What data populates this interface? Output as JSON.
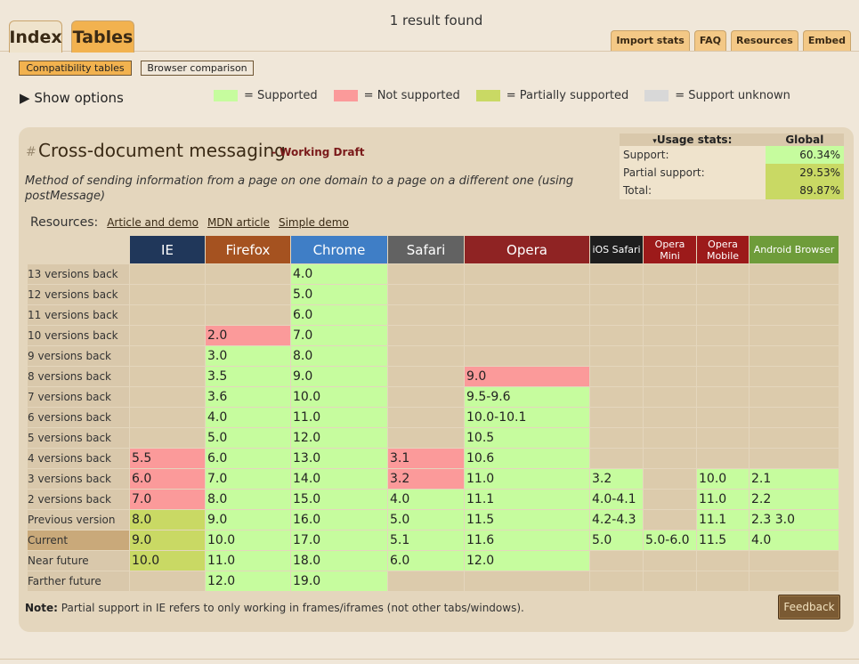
{
  "nav": {
    "index_tab": "Index",
    "tables_tab": "Tables"
  },
  "header": {
    "result": "1 result found"
  },
  "toplinks": [
    "Import stats",
    "FAQ",
    "Resources",
    "Embed"
  ],
  "subnav": {
    "compat": "Compatibility tables",
    "browser": "Browser comparison"
  },
  "options": {
    "show": "Show options"
  },
  "legend": [
    {
      "label": "= Supported",
      "color": "#c6fc9e"
    },
    {
      "label": "= Not supported",
      "color": "#fb9a9a"
    },
    {
      "label": "= Partially supported",
      "color": "#c9d964"
    },
    {
      "label": "= Support unknown",
      "color": "#d8d8d8"
    }
  ],
  "feature": {
    "hash": "#",
    "title": "Cross-document messaging",
    "status": "- Working Draft",
    "description": "Method of sending information from a page on one domain to a page on a different one (using postMessage)",
    "resources_label": "Resources:",
    "resources": [
      "Article and demo",
      "MDN article",
      "Simple demo"
    ]
  },
  "usage": {
    "header": "Usage stats:",
    "scope": "Global",
    "rows": [
      {
        "label": "Support:",
        "value": "60.34%",
        "color": "#c6fc9e"
      },
      {
        "label": "Partial support:",
        "value": "29.53%",
        "color": "#c9d964"
      },
      {
        "label": "Total:",
        "value": "89.87%",
        "color": "#c9d964"
      }
    ]
  },
  "browsers": [
    {
      "name": "IE",
      "color": "#20375a"
    },
    {
      "name": "Firefox",
      "color": "#a55220"
    },
    {
      "name": "Chrome",
      "color": "#3f7ec6"
    },
    {
      "name": "Safari",
      "color": "#626262"
    },
    {
      "name": "Opera",
      "color": "#8f2323"
    },
    {
      "name": "iOS Safari",
      "color": "#1e1e1e"
    },
    {
      "name": "Opera Mini",
      "color": "#9c1a1a"
    },
    {
      "name": "Opera Mobile",
      "color": "#9c1a1a"
    },
    {
      "name": "Android Browser",
      "color": "#6e9c3a"
    }
  ],
  "rows": [
    {
      "label": "13 versions back",
      "cells": [
        [
          "",
          ""
        ],
        [
          "",
          ""
        ],
        [
          "4.0",
          "y"
        ],
        [
          "",
          ""
        ],
        [
          "",
          ""
        ],
        [
          "",
          ""
        ],
        [
          "",
          ""
        ],
        [
          "",
          ""
        ],
        [
          "",
          ""
        ]
      ]
    },
    {
      "label": "12 versions back",
      "cells": [
        [
          "",
          ""
        ],
        [
          "",
          ""
        ],
        [
          "5.0",
          "y"
        ],
        [
          "",
          ""
        ],
        [
          "",
          ""
        ],
        [
          "",
          ""
        ],
        [
          "",
          ""
        ],
        [
          "",
          ""
        ],
        [
          "",
          ""
        ]
      ]
    },
    {
      "label": "11 versions back",
      "cells": [
        [
          "",
          ""
        ],
        [
          "",
          ""
        ],
        [
          "6.0",
          "y"
        ],
        [
          "",
          ""
        ],
        [
          "",
          ""
        ],
        [
          "",
          ""
        ],
        [
          "",
          ""
        ],
        [
          "",
          ""
        ],
        [
          "",
          ""
        ]
      ]
    },
    {
      "label": "10 versions back",
      "cells": [
        [
          "",
          ""
        ],
        [
          "2.0",
          "n"
        ],
        [
          "7.0",
          "y"
        ],
        [
          "",
          ""
        ],
        [
          "",
          ""
        ],
        [
          "",
          ""
        ],
        [
          "",
          ""
        ],
        [
          "",
          ""
        ],
        [
          "",
          ""
        ]
      ]
    },
    {
      "label": "9 versions back",
      "cells": [
        [
          "",
          ""
        ],
        [
          "3.0",
          "y"
        ],
        [
          "8.0",
          "y"
        ],
        [
          "",
          ""
        ],
        [
          "",
          ""
        ],
        [
          "",
          ""
        ],
        [
          "",
          ""
        ],
        [
          "",
          ""
        ],
        [
          "",
          ""
        ]
      ]
    },
    {
      "label": "8 versions back",
      "cells": [
        [
          "",
          ""
        ],
        [
          "3.5",
          "y"
        ],
        [
          "9.0",
          "y"
        ],
        [
          "",
          ""
        ],
        [
          "9.0",
          "n"
        ],
        [
          "",
          ""
        ],
        [
          "",
          ""
        ],
        [
          "",
          ""
        ],
        [
          "",
          ""
        ]
      ]
    },
    {
      "label": "7 versions back",
      "cells": [
        [
          "",
          ""
        ],
        [
          "3.6",
          "y"
        ],
        [
          "10.0",
          "y"
        ],
        [
          "",
          ""
        ],
        [
          "9.5-9.6",
          "y"
        ],
        [
          "",
          ""
        ],
        [
          "",
          ""
        ],
        [
          "",
          ""
        ],
        [
          "",
          ""
        ]
      ]
    },
    {
      "label": "6 versions back",
      "cells": [
        [
          "",
          ""
        ],
        [
          "4.0",
          "y"
        ],
        [
          "11.0",
          "y"
        ],
        [
          "",
          ""
        ],
        [
          "10.0-10.1",
          "y"
        ],
        [
          "",
          ""
        ],
        [
          "",
          ""
        ],
        [
          "",
          ""
        ],
        [
          "",
          ""
        ]
      ]
    },
    {
      "label": "5 versions back",
      "cells": [
        [
          "",
          ""
        ],
        [
          "5.0",
          "y"
        ],
        [
          "12.0",
          "y"
        ],
        [
          "",
          ""
        ],
        [
          "10.5",
          "y"
        ],
        [
          "",
          ""
        ],
        [
          "",
          ""
        ],
        [
          "",
          ""
        ],
        [
          "",
          ""
        ]
      ]
    },
    {
      "label": "4 versions back",
      "cells": [
        [
          "5.5",
          "n"
        ],
        [
          "6.0",
          "y"
        ],
        [
          "13.0",
          "y"
        ],
        [
          "3.1",
          "n"
        ],
        [
          "10.6",
          "y"
        ],
        [
          "",
          ""
        ],
        [
          "",
          ""
        ],
        [
          "",
          ""
        ],
        [
          "",
          ""
        ]
      ]
    },
    {
      "label": "3 versions back",
      "cells": [
        [
          "6.0",
          "n"
        ],
        [
          "7.0",
          "y"
        ],
        [
          "14.0",
          "y"
        ],
        [
          "3.2",
          "n"
        ],
        [
          "11.0",
          "y"
        ],
        [
          "3.2",
          "y"
        ],
        [
          "",
          ""
        ],
        [
          "10.0",
          "y"
        ],
        [
          "2.1",
          "y"
        ]
      ]
    },
    {
      "label": "2 versions back",
      "cells": [
        [
          "7.0",
          "n"
        ],
        [
          "8.0",
          "y"
        ],
        [
          "15.0",
          "y"
        ],
        [
          "4.0",
          "y"
        ],
        [
          "11.1",
          "y"
        ],
        [
          "4.0-4.1",
          "y"
        ],
        [
          "",
          ""
        ],
        [
          "11.0",
          "y"
        ],
        [
          "2.2",
          "y"
        ]
      ]
    },
    {
      "label": "Previous version",
      "cells": [
        [
          "8.0",
          "p"
        ],
        [
          "9.0",
          "y"
        ],
        [
          "16.0",
          "y"
        ],
        [
          "5.0",
          "y"
        ],
        [
          "11.5",
          "y"
        ],
        [
          "4.2-4.3",
          "y"
        ],
        [
          "",
          ""
        ],
        [
          "11.1",
          "y"
        ],
        [
          "2.3 3.0",
          "y"
        ]
      ]
    },
    {
      "label": "Current",
      "cells": [
        [
          "9.0",
          "p"
        ],
        [
          "10.0",
          "y"
        ],
        [
          "17.0",
          "y"
        ],
        [
          "5.1",
          "y"
        ],
        [
          "11.6",
          "y"
        ],
        [
          "5.0",
          "y"
        ],
        [
          "5.0-6.0",
          "y"
        ],
        [
          "11.5",
          "y"
        ],
        [
          "4.0",
          "y"
        ]
      ]
    },
    {
      "label": "Near future",
      "cells": [
        [
          "10.0",
          "p"
        ],
        [
          "11.0",
          "y"
        ],
        [
          "18.0",
          "y"
        ],
        [
          "6.0",
          "y"
        ],
        [
          "12.0",
          "y"
        ],
        [
          "",
          ""
        ],
        [
          "",
          ""
        ],
        [
          "",
          ""
        ],
        [
          "",
          ""
        ]
      ]
    },
    {
      "label": "Farther future",
      "cells": [
        [
          "",
          ""
        ],
        [
          "12.0",
          "y"
        ],
        [
          "19.0",
          "y"
        ],
        [
          "",
          ""
        ],
        [
          "",
          ""
        ],
        [
          "",
          ""
        ],
        [
          "",
          ""
        ],
        [
          "",
          ""
        ],
        [
          "",
          ""
        ]
      ]
    }
  ],
  "note": {
    "label": "Note:",
    "text": "Partial support in IE refers to only working in frames/iframes (not other tabs/windows)."
  },
  "feedback": "Feedback"
}
